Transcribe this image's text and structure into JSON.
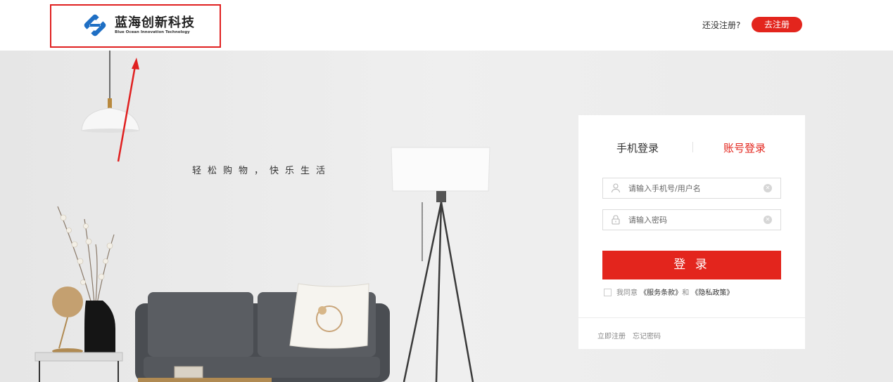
{
  "header": {
    "logo_cn": "蓝海创新科技",
    "logo_en": "Blue Ocean Innovation Technology",
    "not_registered": "还没注册?",
    "register_button": "去注册"
  },
  "hero": {
    "slogan": "轻松购物，快乐生活"
  },
  "login": {
    "tabs": [
      "手机登录",
      "账号登录"
    ],
    "active_tab": "账号登录",
    "username_placeholder": "请输入手机号/用户名",
    "password_placeholder": "请输入密码",
    "submit": "登 录",
    "agree_prefix": "我同意",
    "terms": "《服务条款》",
    "and": "和",
    "privacy": "《隐私政策》",
    "register_link": "立即注册",
    "forgot_link": "忘记密码"
  },
  "colors": {
    "accent": "#e3251d",
    "logo_blue": "#1f6fc4",
    "annotation_red": "#e02020"
  },
  "icons": [
    "logo-mark-icon",
    "user-icon",
    "lock-icon",
    "clear-icon",
    "checkbox-icon",
    "annotation-arrow-icon"
  ]
}
